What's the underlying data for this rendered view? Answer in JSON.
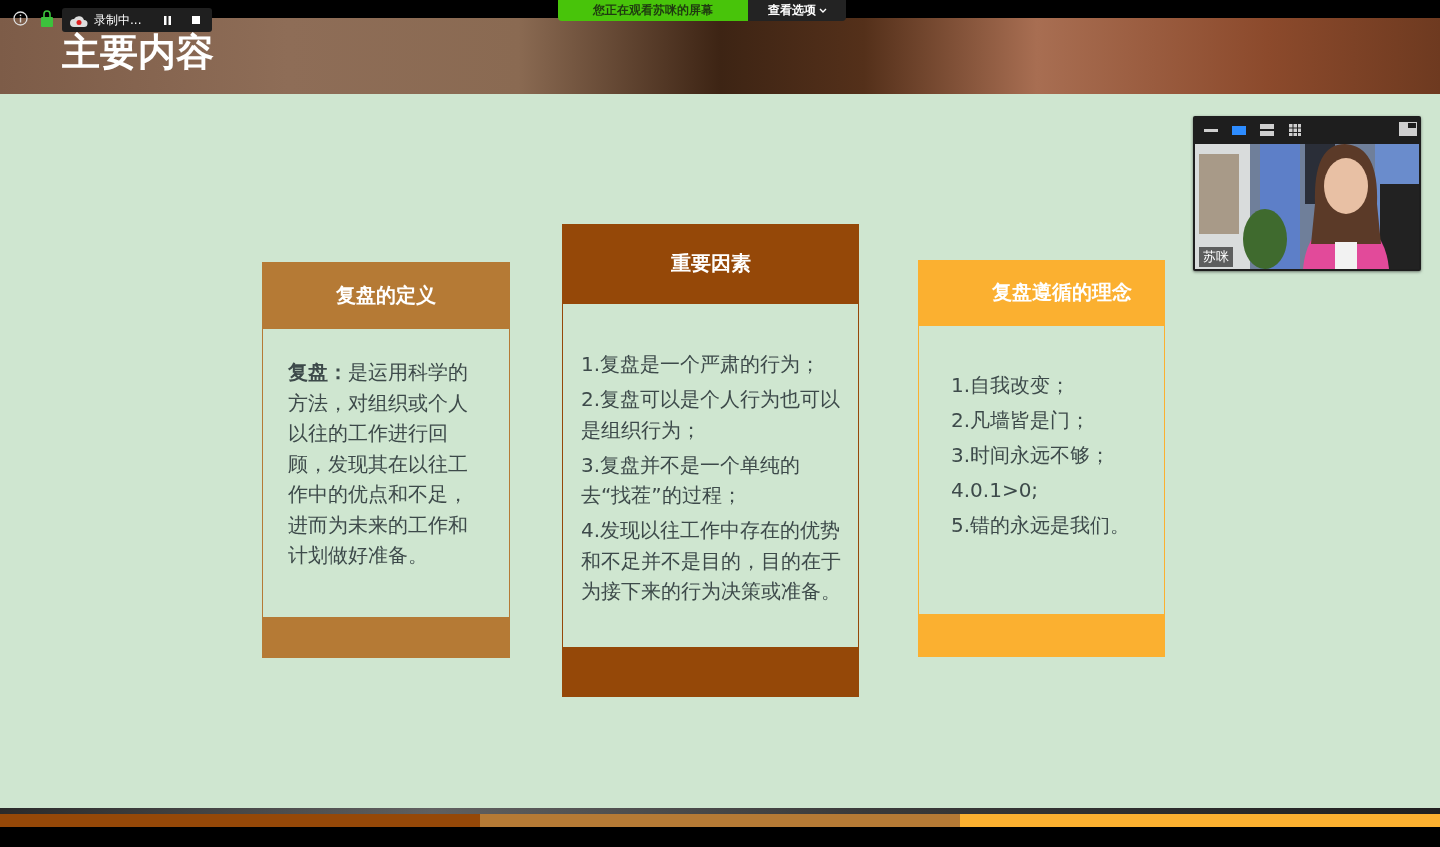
{
  "meeting_bar": {
    "recording_label": "录制中...",
    "viewing_banner": "您正在观看苏咪的屏幕",
    "view_options": "查看选项"
  },
  "slide": {
    "title": "主要内容",
    "cards": [
      {
        "title": "复盘的定义",
        "color": "#b57a35",
        "kind": "paragraph",
        "text": "**复盘：**是运用科学的方法，对组织或个人以往的工作进行回顾，发现其在以往工作中的优点和不足，进而为未来的工作和计划做好准备。"
      },
      {
        "title": "重要因素",
        "color": "#954808",
        "kind": "list",
        "items": [
          "1.复盘是一个严肃的行为；",
          "2.复盘可以是个人行为也可以是组织行为；",
          "3.复盘并不是一个单纯的去“找茬”的过程；",
          "4.发现以往工作中存在的优势和不足并不是目的，目的在于为接下来的行为决策或准备。"
        ]
      },
      {
        "title": "复盘遵循的理念",
        "color": "#fbb030",
        "kind": "list",
        "items": [
          "1.自我改变；",
          "2.凡墙皆是门；",
          "3.时间永远不够；",
          "4.0.1>0;",
          "5.错的永远是我们。"
        ]
      }
    ]
  },
  "video": {
    "participant": "苏咪",
    "view_modes": [
      {
        "kind": "minimize",
        "selected": false
      },
      {
        "kind": "speaker",
        "selected": true
      },
      {
        "kind": "strip",
        "selected": false
      },
      {
        "kind": "grid",
        "selected": false
      }
    ]
  }
}
